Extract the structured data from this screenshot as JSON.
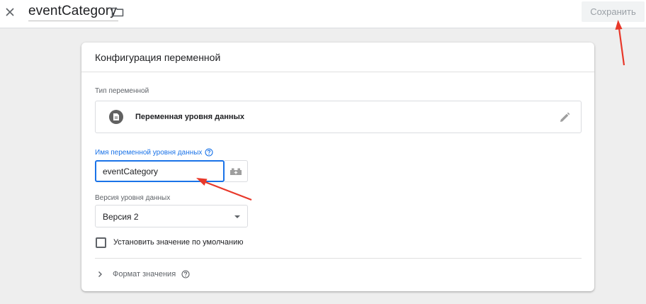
{
  "header": {
    "title": "eventCategory",
    "save_label": "Сохранить",
    "icons": {
      "close": "close-icon",
      "folder": "folder-icon"
    }
  },
  "card": {
    "title": "Конфигурация переменной",
    "type_section_label": "Тип переменной",
    "variable_type": "Переменная уровня данных",
    "variable_name_label": "Имя переменной уровня данных",
    "variable_name_value": "eventCategory",
    "version_label": "Версия уровня данных",
    "version_value": "Версия 2",
    "default_checkbox_label": "Установить значение по умолчанию",
    "default_checked": false,
    "format_label": "Формат значения"
  },
  "colors": {
    "accent": "#1a73e8",
    "annotation_arrow": "#e8382a",
    "background": "#eeeeee"
  }
}
